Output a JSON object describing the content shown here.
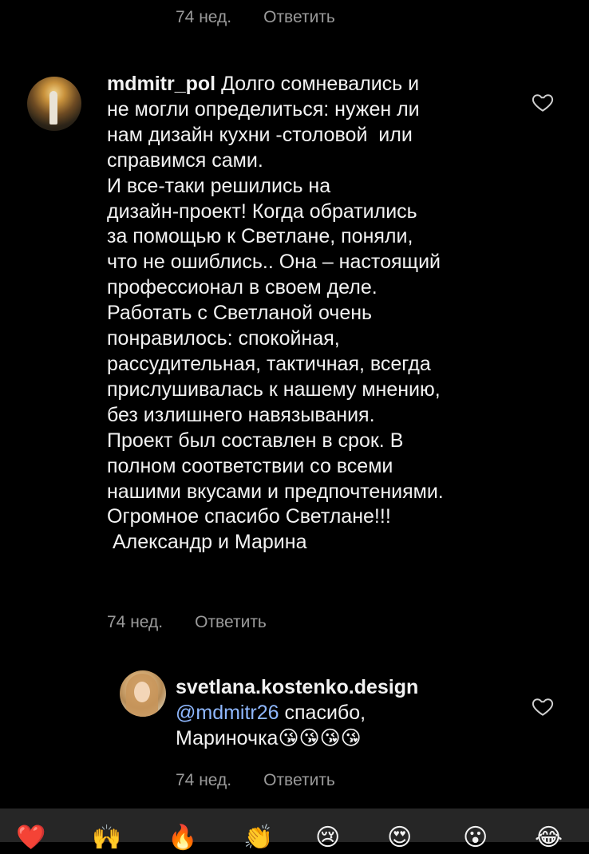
{
  "top_meta": {
    "time": "74 нед.",
    "reply_label": "Ответить"
  },
  "comment": {
    "username": "mdmitr_pol",
    "text": " Долго сомневались и\nне могли определиться: нужен ли\nнам дизайн кухни -столовой  или\nсправимся сами.\nИ все-таки решились на\nдизайн-проект! Когда обратились\nза помощью к Светлане, поняли,\nчто не ошиблись.. Она – настоящий\nпрофессионал в своем деле.\nРаботать с Светланой очень\nпонравилось: спокойная,\nрассудительная, тактичная, всегда\nприслушивалась к нашему мнению,\nбез излишнего навязывания.\nПроект был составлен в срок. В\nполном соответствии со всеми\nнашими вкусами и предпочтениями.\nОгромное спасибо Светлане!!!\n Александр и Марина",
    "time": "74 нед.",
    "reply_label": "Ответить",
    "like_icon": "heart-outline-icon"
  },
  "reply": {
    "username": "svetlana.kostenko.design",
    "mention": "@mdmitr26",
    "text": " спасибо,\nМариночка😘😘😘😘",
    "time": "74 нед.",
    "reply_label": "Ответить",
    "like_icon": "heart-outline-icon"
  },
  "reactions": [
    "❤️",
    "🙌",
    "🔥",
    "👏",
    "😢",
    "😍",
    "😮",
    "😂"
  ],
  "colors": {
    "background": "#000000",
    "text": "#f2f2f2",
    "meta": "#9a9a9a",
    "mention": "#8fb8ff",
    "bottom_bar": "#262626"
  }
}
